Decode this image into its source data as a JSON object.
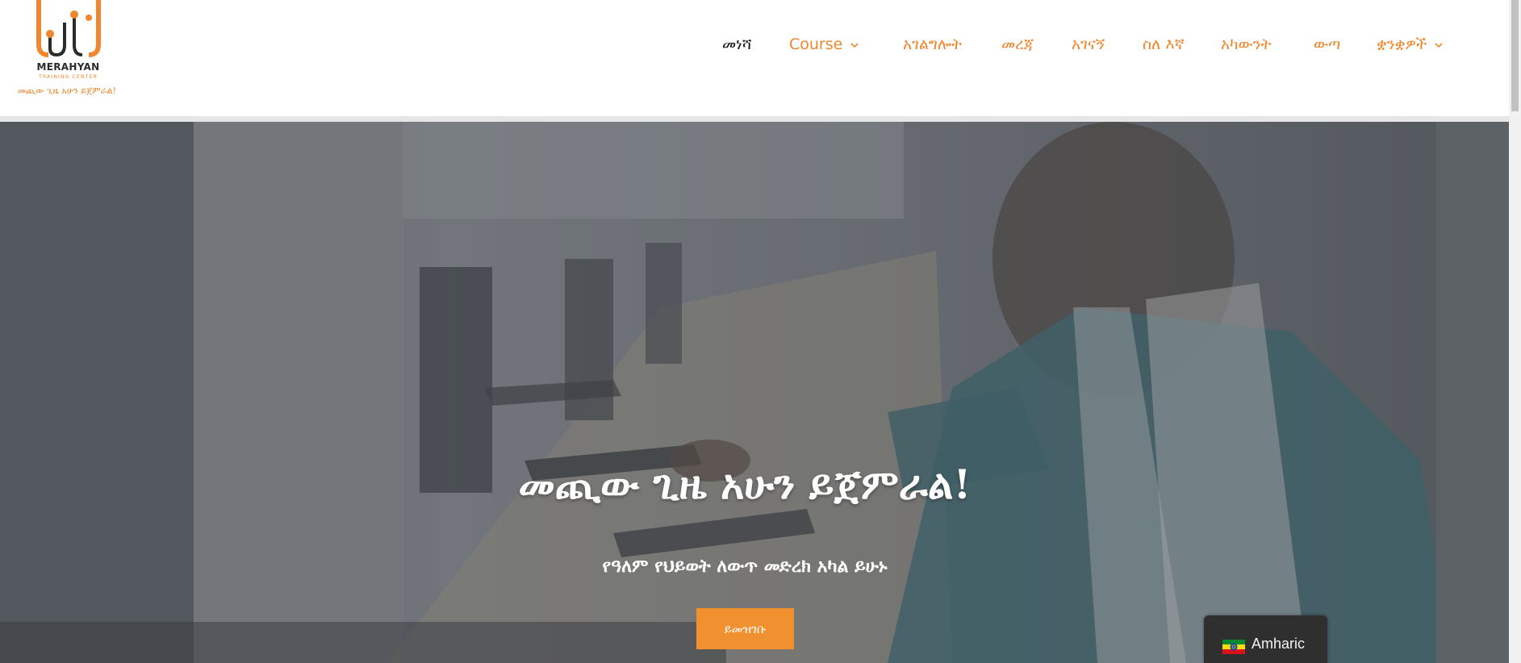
{
  "logo": {
    "name": "MERAHYAN",
    "subtitle": "TRAINING CENTER",
    "tagline": "መጪው ጊዜ አሁን ይጀምራል!"
  },
  "nav": {
    "items": [
      {
        "label": "መነሻ",
        "active": true,
        "dropdown": false
      },
      {
        "label": "Course",
        "active": false,
        "dropdown": true
      },
      {
        "label": "አገልግሎት",
        "active": false,
        "dropdown": false
      },
      {
        "label": "መረጃ",
        "active": false,
        "dropdown": false
      },
      {
        "label": "አገናኝ",
        "active": false,
        "dropdown": false
      },
      {
        "label": "ስለ እኛ",
        "active": false,
        "dropdown": false
      },
      {
        "label": "አካውንት",
        "active": false,
        "dropdown": false
      },
      {
        "label": "ውጣ",
        "active": false,
        "dropdown": false
      },
      {
        "label": "ቋንቋዎች",
        "active": false,
        "dropdown": true
      }
    ]
  },
  "hero": {
    "title": "መጪው ጊዜ አሁን ይጀምራል!",
    "subtitle": "የዓለም የህይወት ለውጥ መድረክ አካል ይሁኑ",
    "button_label": "ይመዝገቡ"
  },
  "language_switcher": {
    "label": "Amharic",
    "flag_icon": "ethiopia-flag-icon"
  },
  "colors": {
    "accent": "#f0862e",
    "button": "#f0902f",
    "nav_active": "#1a1a1a"
  }
}
